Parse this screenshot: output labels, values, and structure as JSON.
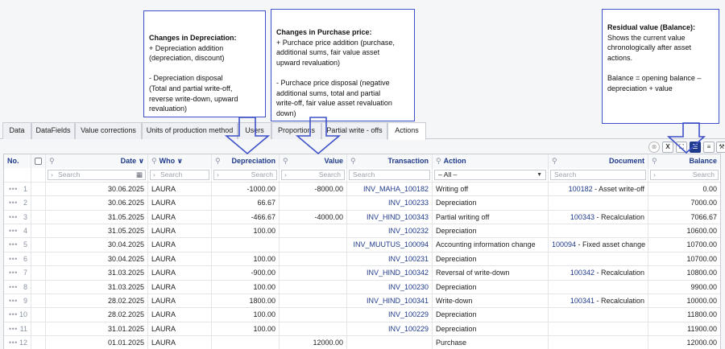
{
  "callouts": {
    "depreciation": {
      "title": "Changes in Depreciation:",
      "lines": [
        "+ Depreciation addition",
        "(depreciation, discount)",
        "",
        "- Depreciation disposal",
        "(Total and partial write-off,",
        "reverse write-down, upward",
        "revaluation)"
      ]
    },
    "purchase": {
      "title": "Changes in Purchase price:",
      "lines": [
        "+ Purchace price addition (purchase,",
        "additional sums, fair value asset",
        "upward revaluation)",
        "",
        "- Purchace price disposal (negative",
        "additional sums, total and partial",
        "write-off, fair value asset revaluation",
        "down)"
      ]
    },
    "residual": {
      "title": "Residual value (Balance):",
      "lines": [
        "Shows the current value",
        "chronologically after asset",
        "actions.",
        "",
        "Balance = opening balance –",
        "depreciation + value"
      ]
    }
  },
  "tabs": [
    "Data",
    "DataFields",
    "Value corrections",
    "Units of production method",
    "Users",
    "Proportions",
    "Partial write - offs",
    "Actions"
  ],
  "active_tab": "Actions",
  "toolbar": {
    "icons": [
      "clear-filter-icon",
      "excel-export-icon",
      "fullscreen-icon",
      "list-view-icon",
      "menu-icon",
      "settings-wrench-icon"
    ],
    "glyphs": [
      "⊗",
      "X",
      "⛶",
      "☰",
      "≡",
      "⚒"
    ]
  },
  "columns": {
    "no": "No.",
    "date": "Date",
    "who": "Who",
    "depreciation": "Depreciation",
    "value": "Value",
    "transaction": "Transaction",
    "action": "Action",
    "document": "Document",
    "balance": "Balance"
  },
  "filters": {
    "search": "Search",
    "action_selected": "– All –"
  },
  "rows": [
    {
      "no": "1",
      "date": "30.06.2025",
      "who": "LAURA",
      "depreciation": "-1000.00",
      "value": "-8000.00",
      "transaction": "INV_MAHA_100182",
      "action": "Writing off",
      "doc_no": "100182",
      "doc_text": " - Asset write-off",
      "balance": "0.00"
    },
    {
      "no": "2",
      "date": "30.06.2025",
      "who": "LAURA",
      "depreciation": "66.67",
      "value": "",
      "transaction": "INV_100233",
      "action": "Depreciation",
      "doc_no": "",
      "doc_text": "",
      "balance": "7000.00"
    },
    {
      "no": "3",
      "date": "31.05.2025",
      "who": "LAURA",
      "depreciation": "-466.67",
      "value": "-4000.00",
      "transaction": "INV_HIND_100343",
      "action": "Partial writing off",
      "doc_no": "100343",
      "doc_text": " - Recalculation",
      "balance": "7066.67"
    },
    {
      "no": "4",
      "date": "31.05.2025",
      "who": "LAURA",
      "depreciation": "100.00",
      "value": "",
      "transaction": "INV_100232",
      "action": "Depreciation",
      "doc_no": "",
      "doc_text": "",
      "balance": "10600.00"
    },
    {
      "no": "5",
      "date": "30.04.2025",
      "who": "LAURA",
      "depreciation": "",
      "value": "",
      "transaction": "INV_MUUTUS_100094",
      "action": "Accounting information change",
      "doc_no": "100094",
      "doc_text": " - Fixed asset change",
      "balance": "10700.00"
    },
    {
      "no": "6",
      "date": "30.04.2025",
      "who": "LAURA",
      "depreciation": "100.00",
      "value": "",
      "transaction": "INV_100231",
      "action": "Depreciation",
      "doc_no": "",
      "doc_text": "",
      "balance": "10700.00"
    },
    {
      "no": "7",
      "date": "31.03.2025",
      "who": "LAURA",
      "depreciation": "-900.00",
      "value": "",
      "transaction": "INV_HIND_100342",
      "action": "Reversal of write-down",
      "doc_no": "100342",
      "doc_text": " - Recalculation",
      "balance": "10800.00"
    },
    {
      "no": "8",
      "date": "31.03.2025",
      "who": "LAURA",
      "depreciation": "100.00",
      "value": "",
      "transaction": "INV_100230",
      "action": "Depreciation",
      "doc_no": "",
      "doc_text": "",
      "balance": "9900.00"
    },
    {
      "no": "9",
      "date": "28.02.2025",
      "who": "LAURA",
      "depreciation": "1800.00",
      "value": "",
      "transaction": "INV_HIND_100341",
      "action": "Write-down",
      "doc_no": "100341",
      "doc_text": " - Recalculation",
      "balance": "10000.00"
    },
    {
      "no": "10",
      "date": "28.02.2025",
      "who": "LAURA",
      "depreciation": "100.00",
      "value": "",
      "transaction": "INV_100229",
      "action": "Depreciation",
      "doc_no": "",
      "doc_text": "",
      "balance": "11800.00"
    },
    {
      "no": "11",
      "date": "31.01.2025",
      "who": "LAURA",
      "depreciation": "100.00",
      "value": "",
      "transaction": "INV_100229",
      "action": "Depreciation",
      "doc_no": "",
      "doc_text": "",
      "balance": "11900.00"
    },
    {
      "no": "12",
      "date": "01.01.2025",
      "who": "LAURA",
      "depreciation": "",
      "value": "12000.00",
      "transaction": "",
      "action": "Purchase",
      "doc_no": "",
      "doc_text": "",
      "balance": "12000.00"
    }
  ],
  "colors": {
    "accent": "#1f3a8a",
    "callout_border": "#3f51c8",
    "link": "#1f3a8a"
  }
}
